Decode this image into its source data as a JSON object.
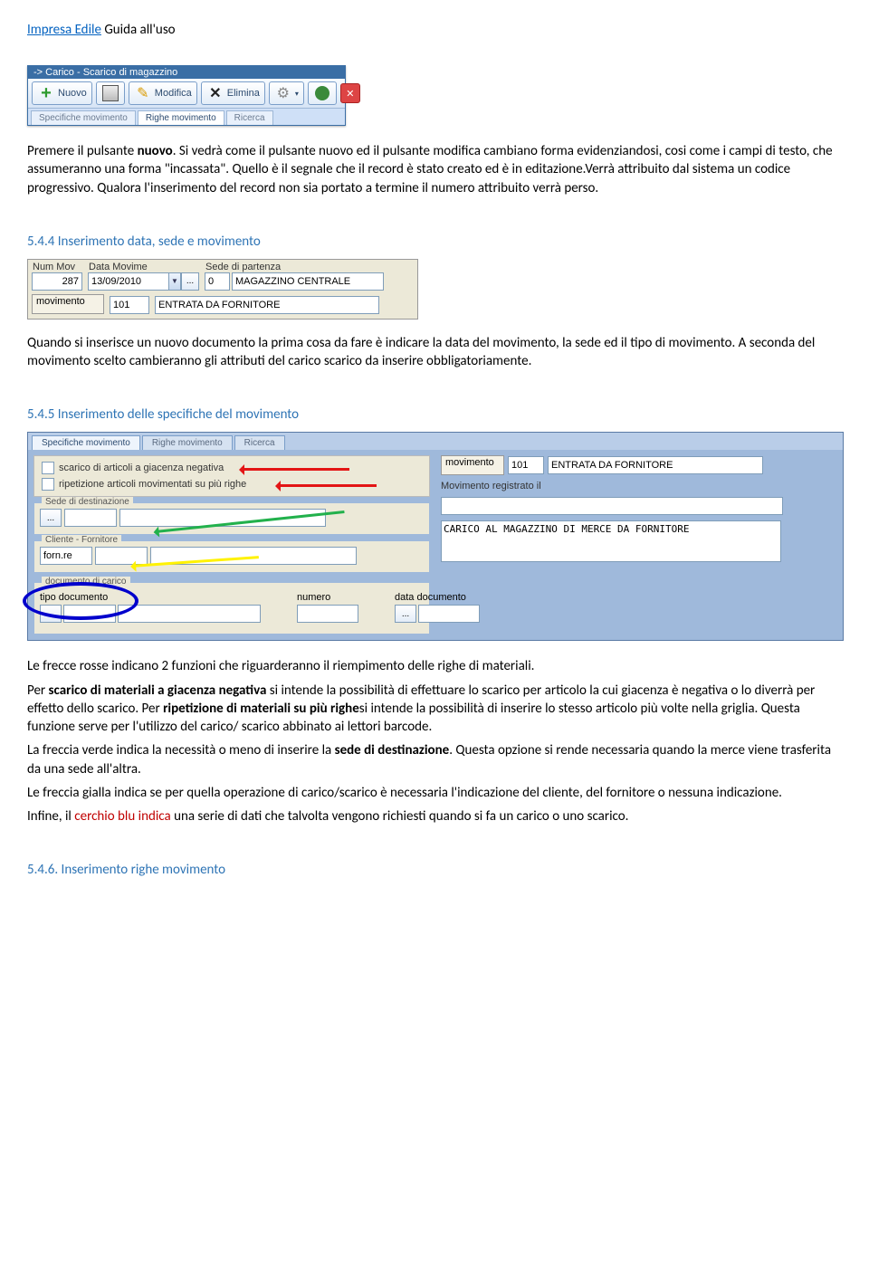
{
  "header": {
    "link": "Impresa Edile",
    "rest": " Guida all'uso"
  },
  "toolbar": {
    "title": "-> Carico - Scarico di magazzino",
    "btn_nuovo": "Nuovo",
    "btn_modifica": "Modifica",
    "btn_elimina": "Elimina",
    "tab1": "Specifiche movimento",
    "tab2": "Righe movimento",
    "tab3": "Ricerca"
  },
  "para1a": "Premere il pulsante ",
  "para1b": "nuovo",
  "para1c": ". Si vedrà come il pulsante nuovo ed il pulsante modifica cambiano forma evidenziandosi, cosi come i campi di testo, che assumeranno una forma \"incassata\". Quello è il segnale che il record è stato creato ed è in editazione.Verrà attribuito dal sistema un codice progressivo. Qualora l'inserimento del record non sia portato a termine il numero attribuito verrà perso.",
  "h544": "5.4.4 Inserimento data, sede e movimento",
  "fields": {
    "lbl_num": "Num Mov",
    "val_num": "287",
    "lbl_data": "Data Movime",
    "val_data": "13/09/2010",
    "lbl_sede": "Sede di partenza",
    "val_sede_code": "0",
    "val_sede_desc": "MAGAZZINO CENTRALE",
    "lbl_mov": "movimento",
    "val_mov_code": "101",
    "val_mov_desc": "ENTRATA DA FORNITORE"
  },
  "para2": "Quando si inserisce un nuovo documento la prima cosa da fare è indicare la data del movimento, la sede ed il tipo di movimento. A seconda del movimento scelto cambieranno gli attributi del carico scarico da inserire obbligatoriamente.",
  "h545": "5.4.5 Inserimento delle specifiche del movimento",
  "spec": {
    "tab1": "Specifiche movimento",
    "tab2": "Righe movimento",
    "tab3": "Ricerca",
    "right_mov_lbl": "movimento",
    "right_mov_code": "101",
    "right_mov_desc": "ENTRATA DA FORNITORE",
    "right_reg_lbl": "Movimento registrato il",
    "right_textarea": "CARICO AL MAGAZZINO DI MERCE DA FORNITORE",
    "check1": "scarico di articoli a giacenza negativa",
    "check2": "ripetizione articoli movimentati su più righe",
    "grp_sede": "Sede di destinazione",
    "grp_clifor": "Cliente - Fornitore",
    "clifor_val": "forn.re",
    "grp_doc": "documento di carico",
    "lbl_tipodoc": "tipo documento",
    "lbl_numero": "numero",
    "lbl_datadoc": "data documento"
  },
  "para3a": "Le frecce rosse indicano 2 funzioni che riguarderanno il riempimento delle righe di materiali.",
  "para3b_pre": "Per ",
  "para3b_bold": "scarico di materiali a giacenza negativa",
  "para3b_mid": " si intende la possibilità di effettuare lo scarico per articolo la cui giacenza è negativa o lo diverrà per effetto dello scarico. Per ",
  "para3b_bold2": "ripetizione di materiali su più righe",
  "para3b_post": "si intende la possibilità di inserire lo stesso articolo più volte nella griglia. Questa funzione serve per l'utilizzo del carico/ scarico abbinato ai lettori barcode.",
  "para4a": "La freccia verde indica la necessità o meno di inserire la ",
  "para4b": "sede di destinazione",
  "para4c": ". Questa opzione si rende necessaria quando la merce viene trasferita da una sede all'altra.",
  "para5": "Le freccia gialla indica se per quella operazione di carico/scarico è necessaria l'indicazione del cliente, del fornitore o nessuna indicazione.",
  "para6a": "Infine, il ",
  "para6b": "cerchio blu indica",
  "para6c": " una serie di dati che talvolta vengono richiesti quando si fa un carico o uno scarico.",
  "h546": "5.4.6. Inserimento righe movimento"
}
